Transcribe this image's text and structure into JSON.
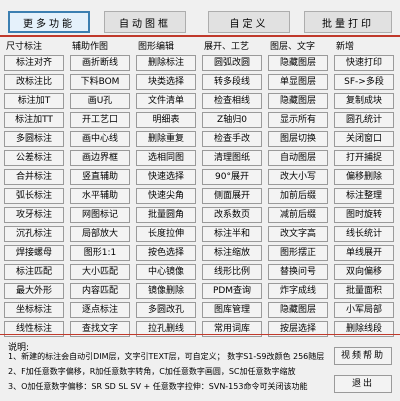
{
  "top": {
    "more_features": "更多功能",
    "auto_drawing_frame": "自动图框",
    "custom": "自定义",
    "batch_print": "批量打印"
  },
  "columns": [
    {
      "header": "尺寸标注",
      "items": [
        "标注对齐",
        "改标注比",
        "标注加T",
        "标注加TT",
        "多圆标注",
        "公差标注",
        "合并标注",
        "弧长标注",
        "攻牙标注",
        "沉孔标注",
        "焊接螺母",
        "标注匹配",
        "最大外形",
        "坐标标注",
        "线性标注"
      ]
    },
    {
      "header": "辅助作图",
      "items": [
        "画折断线",
        "下料BOM",
        "画U孔",
        "开工艺口",
        "画中心线",
        "画边界框",
        "竖直辅助",
        "水平辅助",
        "网图标记",
        "局部放大",
        "图形1:1",
        "大小匹配",
        "内容匹配",
        "逐点标注",
        "查找文字"
      ]
    },
    {
      "header": "图形编辑",
      "items": [
        "删除标注",
        "块类选择",
        "文件清单",
        "明细表",
        "删除重复",
        "选相同图",
        "快速选择",
        "快速尖角",
        "批量圆角",
        "长度拉伸",
        "按色选择",
        "中心镜像",
        "镜像删除",
        "多圆改孔",
        "拉孔删线"
      ]
    },
    {
      "header": "展开、工艺",
      "items": [
        "圆弧改圆",
        "转多段线",
        "检查相线",
        "Z轴归0",
        "检查手改",
        "清理图纸",
        "90°展开",
        "侧面展开",
        "改系数页",
        "标注半和",
        "标注缩放",
        "线形比例",
        "PDM查询",
        "图库管理",
        "常用词库"
      ]
    },
    {
      "header": "图层、文字",
      "items": [
        "隐藏图层",
        "单显图层",
        "隐藏图层",
        "显示所有",
        "图层切换",
        "自动图层",
        "改大小写",
        "加前后缀",
        "减前后缀",
        "改文字高",
        "图形摆正",
        "替换问号",
        "炸字成线",
        "隐藏图层",
        "按层选择"
      ]
    },
    {
      "header": "新增",
      "items": [
        "快速打印",
        "SF->多段",
        "复制成块",
        "圆孔统计",
        "关闭窗口",
        "打开捕捉",
        "偏移删除",
        "标注整理",
        "图时旋转",
        "线长统计",
        "单线展开",
        "双向偏移",
        "批量面积",
        "小军局部",
        "删除线段"
      ]
    }
  ],
  "notes": {
    "title": "说明:",
    "line1": "1、新建的标注会自动引DIM层，文字引TEXT层，可自定义；  数字S1-S9改颜色 256随层",
    "line2": "2、F加任意数字偏移，R加任意数字转角，C加任意数字画圆，SC加任意数字缩放",
    "line3": "3、O加任意数字偏移：SR SD SL SV + 任意数字拉伸：SVN-153命令可关闭该功能"
  },
  "side": {
    "video_help": "视频帮助",
    "exit": "退出"
  },
  "colors": {
    "divider": "#c0392b",
    "active_border": "#3c7fb1"
  }
}
